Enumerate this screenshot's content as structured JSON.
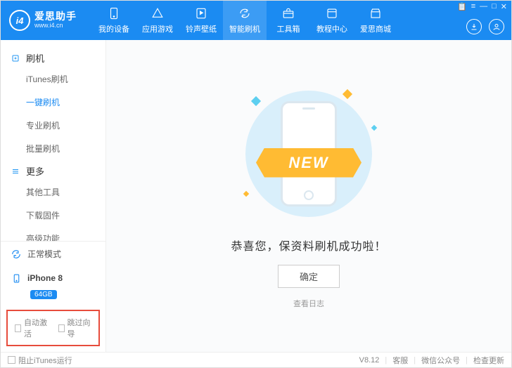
{
  "app": {
    "brand": "爱思助手",
    "site": "www.i4.cn",
    "logo_glyph": "i4"
  },
  "window_controls": [
    "📋",
    "≡",
    "—",
    "□",
    "✕"
  ],
  "topnav": [
    {
      "label": "我的设备",
      "icon": "phone"
    },
    {
      "label": "应用游戏",
      "icon": "apps"
    },
    {
      "label": "铃声壁纸",
      "icon": "music"
    },
    {
      "label": "智能刷机",
      "icon": "refresh",
      "active": true
    },
    {
      "label": "工具箱",
      "icon": "toolbox"
    },
    {
      "label": "教程中心",
      "icon": "book"
    },
    {
      "label": "爱思商城",
      "icon": "store"
    }
  ],
  "sidebar": {
    "groups": [
      {
        "title": "刷机",
        "icon": "plus",
        "items": [
          {
            "label": "iTunes刷机"
          },
          {
            "label": "一键刷机",
            "active": true
          },
          {
            "label": "专业刷机"
          },
          {
            "label": "批量刷机"
          }
        ]
      },
      {
        "title": "更多",
        "icon": "more",
        "items": [
          {
            "label": "其他工具"
          },
          {
            "label": "下载固件"
          },
          {
            "label": "高级功能"
          }
        ]
      }
    ],
    "status": {
      "mode": "正常模式"
    },
    "device": {
      "name": "iPhone 8",
      "storage": "64GB"
    },
    "checks": [
      {
        "label": "自动激活"
      },
      {
        "label": "跳过向导"
      }
    ]
  },
  "main": {
    "ribbon": "NEW",
    "message": "恭喜您，保资料刷机成功啦！",
    "ok": "确定",
    "log": "查看日志"
  },
  "footer": {
    "block_itunes": "阻止iTunes运行",
    "version": "V8.12",
    "links": [
      "客服",
      "微信公众号",
      "检查更新"
    ]
  }
}
